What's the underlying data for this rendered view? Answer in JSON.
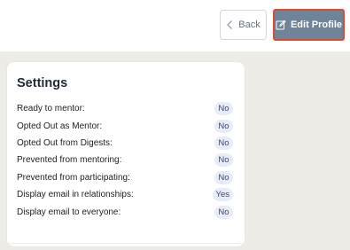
{
  "header": {
    "back_label": "Back",
    "edit_profile_label": "Edit Profile"
  },
  "settings": {
    "title": "Settings",
    "rows": [
      {
        "label": "Ready to mentor:",
        "value": "No"
      },
      {
        "label": "Opted Out as Mentor:",
        "value": "No"
      },
      {
        "label": "Opted Out from Digests:",
        "value": "No"
      },
      {
        "label": "Prevented from mentoring:",
        "value": "No"
      },
      {
        "label": "Prevented from participating:",
        "value": "No"
      },
      {
        "label": "Display email in relationships:",
        "value": "Yes"
      },
      {
        "label": "Display email to everyone:",
        "value": "No"
      }
    ]
  },
  "icons": {
    "back": "chevron-left-icon",
    "edit": "pencil-square-icon"
  },
  "colors": {
    "edit_button_bg": "#6f8399",
    "edit_button_border": "#e04a2f",
    "pill_bg": "#e7ecf8",
    "page_bg": "#edece6"
  }
}
